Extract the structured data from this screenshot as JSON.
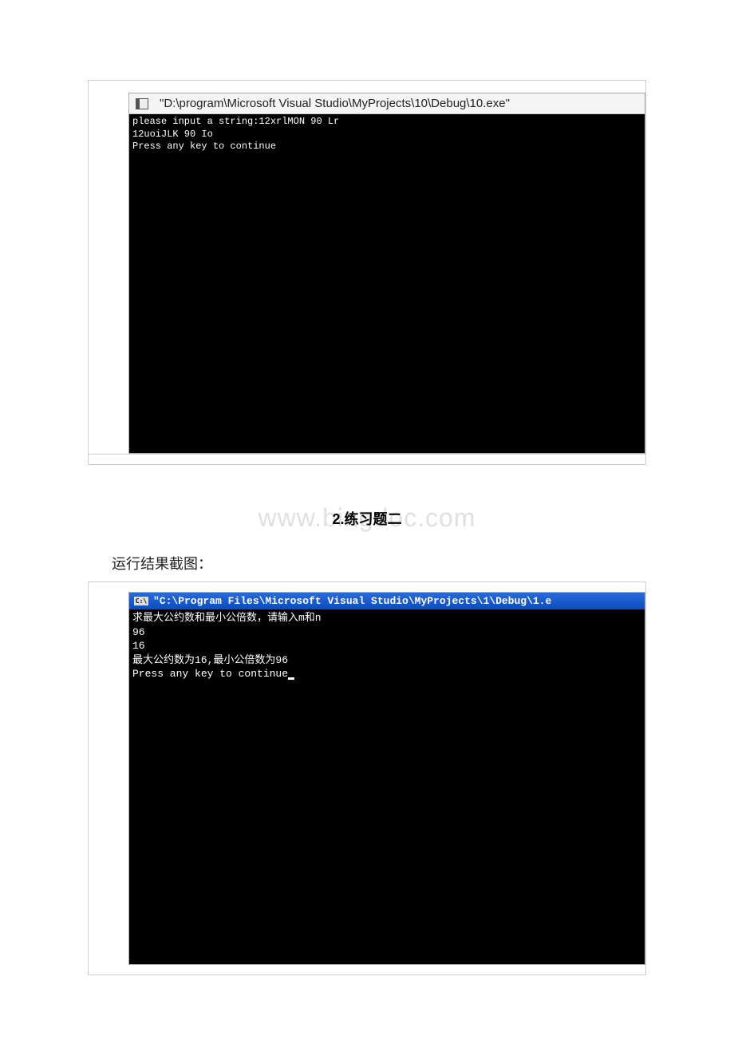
{
  "console1": {
    "title": "\"D:\\program\\Microsoft Visual Studio\\MyProjects\\10\\Debug\\10.exe\"",
    "line1": "please input a string:12xrlMON 90 Lr",
    "line2": "12uoiJLK 90 Io",
    "line3": "Press any key to continue"
  },
  "watermark": "www.bingdoc.com",
  "section_heading": "2.练习题二",
  "caption": "运行结果截图：",
  "console2": {
    "title_icon": "C:\\",
    "title": "\"C:\\Program Files\\Microsoft Visual Studio\\MyProjects\\1\\Debug\\1.e",
    "line1": "求最大公约数和最小公倍数，请输入m和n",
    "line2": "96",
    "line3": "16",
    "line4": "最大公约数为16,最小公倍数为96",
    "line5": "Press any key to continue"
  }
}
